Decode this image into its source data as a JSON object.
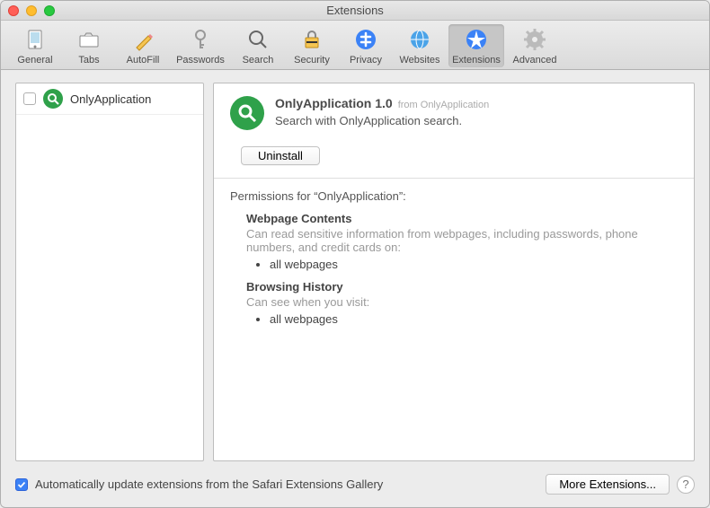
{
  "window": {
    "title": "Extensions"
  },
  "toolbar": {
    "items": [
      {
        "label": "General"
      },
      {
        "label": "Tabs"
      },
      {
        "label": "AutoFill"
      },
      {
        "label": "Passwords"
      },
      {
        "label": "Search"
      },
      {
        "label": "Security"
      },
      {
        "label": "Privacy"
      },
      {
        "label": "Websites"
      },
      {
        "label": "Extensions"
      },
      {
        "label": "Advanced"
      }
    ],
    "selected_index": 8
  },
  "sidebar": {
    "items": [
      {
        "name": "OnlyApplication",
        "enabled": false
      }
    ]
  },
  "details": {
    "title": "OnlyApplication 1.0",
    "from_label": "from OnlyApplication",
    "description": "Search with OnlyApplication search.",
    "uninstall_label": "Uninstall",
    "permissions_header": "Permissions for “OnlyApplication”:",
    "sections": [
      {
        "heading": "Webpage Contents",
        "body": "Can read sensitive information from webpages, including passwords, phone numbers, and credit cards on:",
        "items": [
          "all webpages"
        ]
      },
      {
        "heading": "Browsing History",
        "body": "Can see when you visit:",
        "items": [
          "all webpages"
        ]
      }
    ]
  },
  "footer": {
    "auto_update_label": "Automatically update extensions from the Safari Extensions Gallery",
    "auto_update_checked": true,
    "more_label": "More Extensions...",
    "help_label": "?"
  },
  "colors": {
    "ext_icon_bg": "#2fa14a",
    "accent": "#3b82f6"
  }
}
